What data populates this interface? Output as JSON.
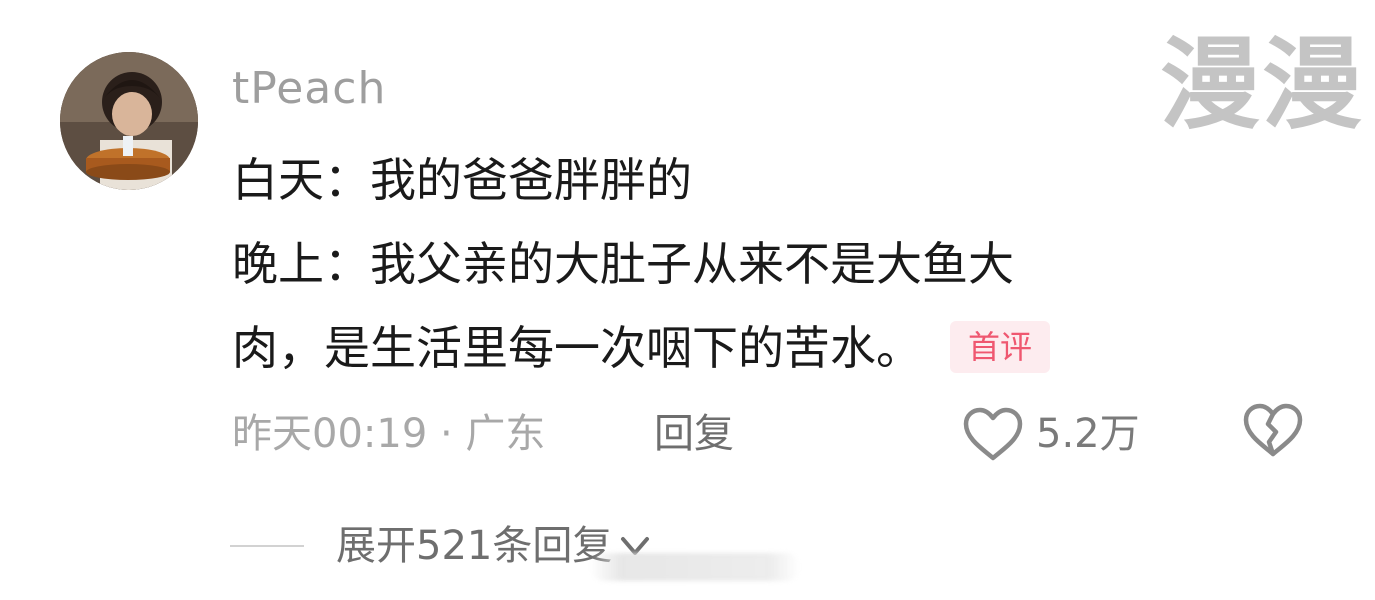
{
  "comment": {
    "username": "tPeach",
    "lines": [
      "白天：我的爸爸胖胖的",
      "晚上：我父亲的大肚子从来不是大鱼大",
      "肉，是生活里每一次咽下的苦水。"
    ],
    "badge": "首评",
    "meta": "昨天00:19 · 广东",
    "reply_label": "回复",
    "like_count": "5.2万",
    "expand_label": "展开521条回复"
  },
  "watermark": "漫漫",
  "icons": {
    "avatar": "avatar-photo",
    "like": "heart-outline-icon",
    "dislike": "broken-heart-icon",
    "expand": "chevron-down-icon"
  },
  "colors": {
    "text": "#1a1a1a",
    "muted": "#a8a8a8",
    "badge_bg": "#fdecef",
    "badge_text": "#ef5770"
  }
}
